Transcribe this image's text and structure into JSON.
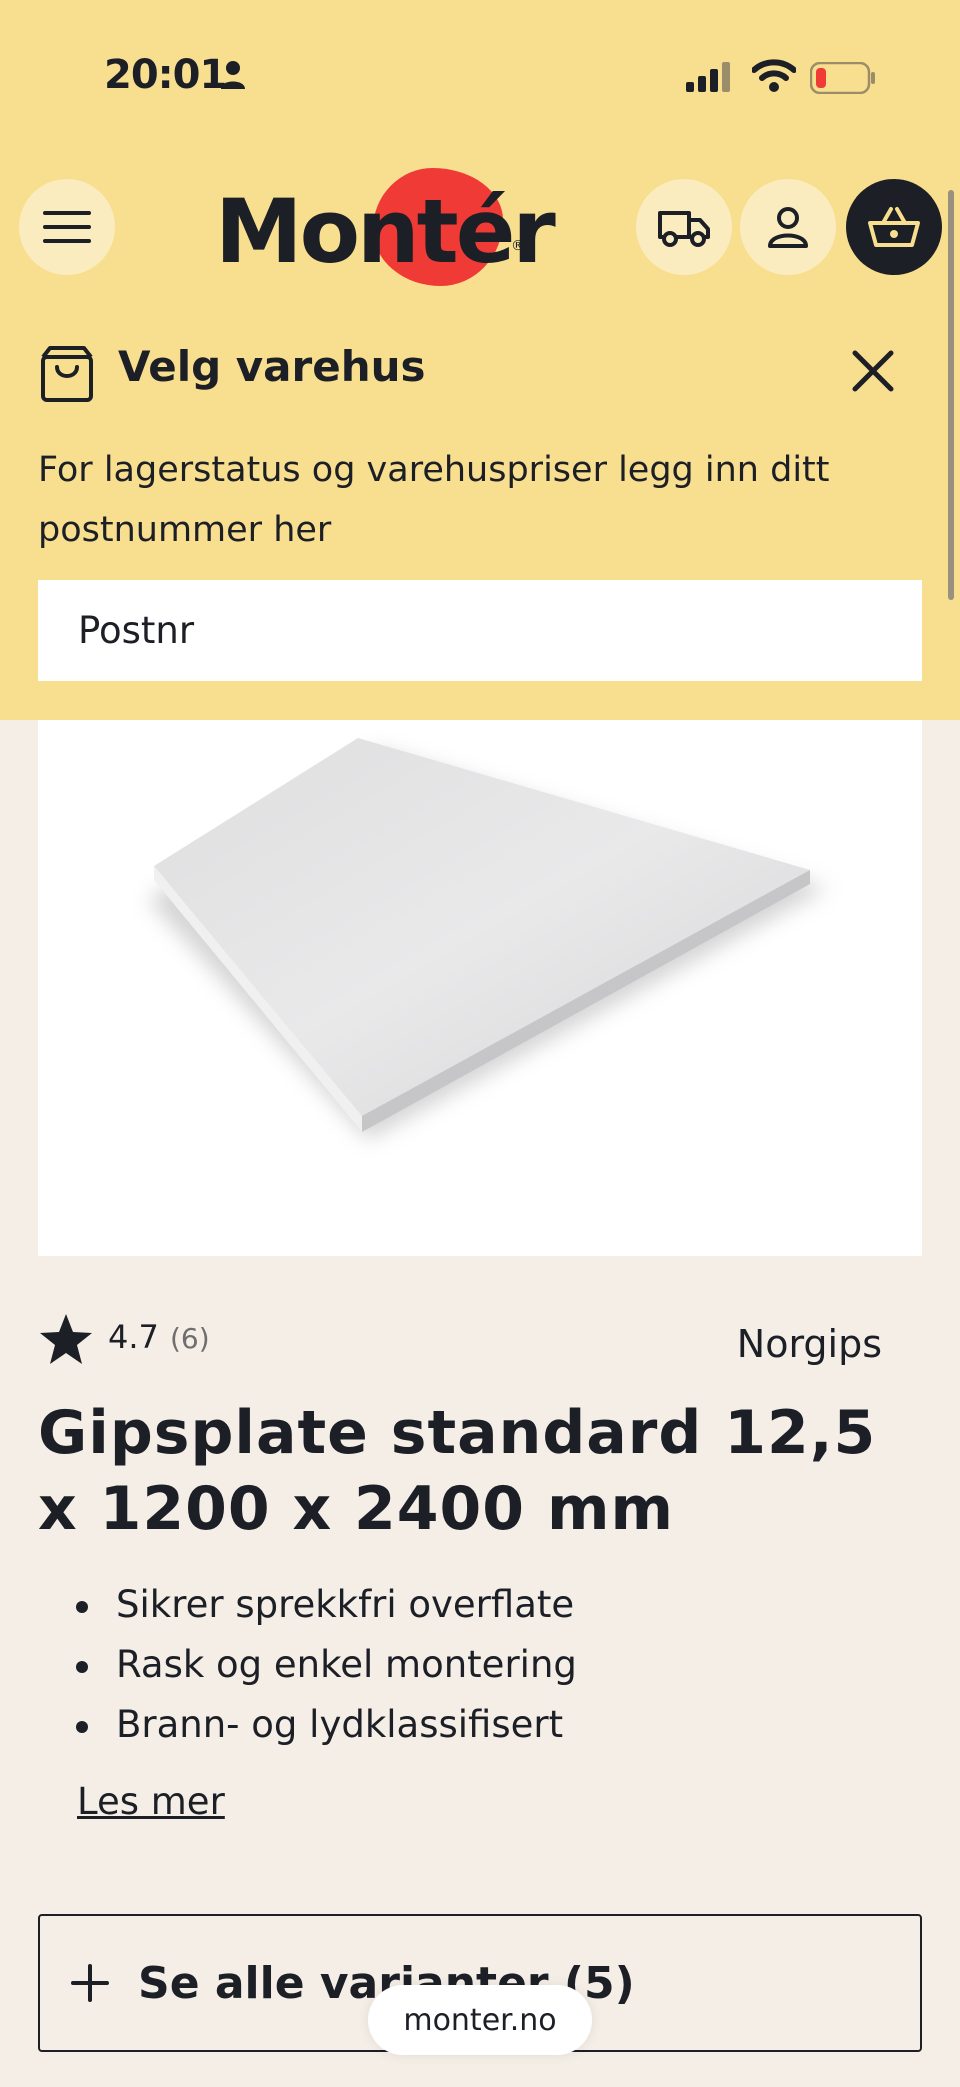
{
  "status_bar": {
    "time": "20:01"
  },
  "header": {
    "logo_text": "Montér"
  },
  "store_picker": {
    "title": "Velg varehus",
    "description": "For lagerstatus og varehuspriser legg inn ditt postnummer her",
    "input_placeholder": "Postnr"
  },
  "product": {
    "rating": "4.7",
    "review_count": "(6)",
    "brand": "Norgips",
    "title": "Gipsplate standard 12,5 x 1200 x 2400 mm",
    "features": [
      "Sikrer sprekkfri overflate",
      "Rask og enkel montering",
      "Brann- og lydklassifisert"
    ],
    "read_more": "Les mer",
    "variants_button": "Se alle varianter (5)"
  },
  "browser": {
    "url": "monter.no"
  },
  "colors": {
    "header_bg": "#f8de8f",
    "page_bg": "#f4eee7",
    "logo_accent": "#ef3a36",
    "text": "#1c1f26"
  }
}
